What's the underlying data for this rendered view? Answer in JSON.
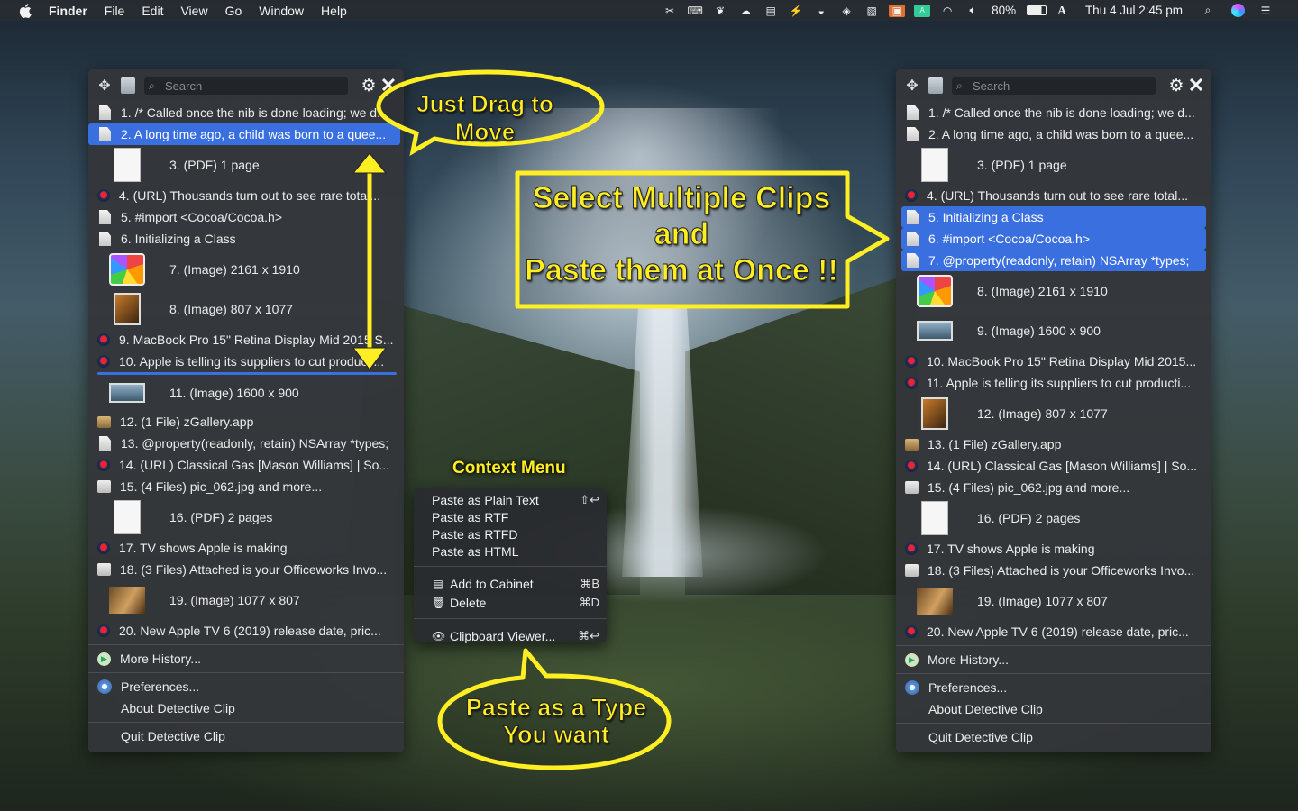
{
  "menubar": {
    "app_name": "Finder",
    "items": [
      "File",
      "Edit",
      "View",
      "Go",
      "Window",
      "Help"
    ],
    "battery": "80%",
    "input_source": "A",
    "datetime": "Thu 4 Jul  2:45 pm"
  },
  "left_panel": {
    "search_placeholder": "Search",
    "clips": [
      {
        "label": "1. /* Called once the nib is done loading; we d...",
        "icon": "document-icon"
      },
      {
        "label": "2. A long time ago, a child was born to a quee...",
        "icon": "document-icon",
        "selected": true
      },
      {
        "label": "3. (PDF) 1 page",
        "icon": "pdf-thumbnail"
      },
      {
        "label": "4. (URL) Thousands turn out to see rare total...",
        "icon": "url-icon"
      },
      {
        "label": "5. #import <Cocoa/Cocoa.h>",
        "icon": "document-icon"
      },
      {
        "label": "6. Initializing a Class",
        "icon": "document-icon"
      },
      {
        "label": "7. (Image) 2161 x 1910",
        "icon": "image-thumbnail"
      },
      {
        "label": "8. (Image) 807 x 1077",
        "icon": "image-thumbnail"
      },
      {
        "label": "9. MacBook Pro 15\" Retina Display Mid 2015 S...",
        "icon": "url-icon"
      },
      {
        "label": "10. Apple is telling its suppliers to cut producti...",
        "icon": "url-icon"
      },
      {
        "label": "11. (Image) 1600 x 900",
        "icon": "image-thumbnail"
      },
      {
        "label": "12. (1 File) zGallery.app",
        "icon": "app-icon"
      },
      {
        "label": "13. @property(readonly, retain) NSArray *types;",
        "icon": "document-icon"
      },
      {
        "label": "14. (URL) Classical Gas [Mason Williams] | So...",
        "icon": "url-icon"
      },
      {
        "label": "15. (4 Files) pic_062.jpg and more...",
        "icon": "files-icon"
      },
      {
        "label": "16. (PDF) 2 pages",
        "icon": "pdf-thumbnail"
      },
      {
        "label": "17. TV shows Apple is making",
        "icon": "url-icon"
      },
      {
        "label": "18. (3 Files) Attached is your Officeworks Invo...",
        "icon": "files-icon"
      },
      {
        "label": "19. (Image) 1077 x 807",
        "icon": "image-thumbnail"
      },
      {
        "label": "20. New Apple TV 6 (2019) release date, pric...",
        "icon": "url-icon"
      }
    ],
    "more_history": "More History...",
    "preferences": "Preferences...",
    "about": "About Detective Clip",
    "quit": "Quit Detective Clip"
  },
  "right_panel": {
    "search_placeholder": "Search",
    "clips": [
      {
        "label": "1. /* Called once the nib is done loading; we d...",
        "icon": "document-icon"
      },
      {
        "label": "2. A long time ago, a child was born to a quee...",
        "icon": "document-icon"
      },
      {
        "label": "3. (PDF) 1 page",
        "icon": "pdf-thumbnail"
      },
      {
        "label": "4. (URL) Thousands turn out to see rare total...",
        "icon": "url-icon"
      },
      {
        "label": "5. Initializing a Class",
        "icon": "document-icon",
        "selected": true
      },
      {
        "label": "6. #import <Cocoa/Cocoa.h>",
        "icon": "document-icon",
        "selected": true
      },
      {
        "label": "7. @property(readonly, retain) NSArray *types;",
        "icon": "document-icon",
        "selected": true
      },
      {
        "label": "8. (Image) 2161 x 1910",
        "icon": "image-thumbnail"
      },
      {
        "label": "9. (Image) 1600 x 900",
        "icon": "image-thumbnail"
      },
      {
        "label": "10. MacBook Pro 15\" Retina Display Mid 2015...",
        "icon": "url-icon"
      },
      {
        "label": "11. Apple is telling its suppliers to cut producti...",
        "icon": "url-icon"
      },
      {
        "label": "12. (Image) 807 x 1077",
        "icon": "image-thumbnail"
      },
      {
        "label": "13. (1 File) zGallery.app",
        "icon": "app-icon"
      },
      {
        "label": "14. (URL) Classical Gas [Mason Williams] | So...",
        "icon": "url-icon"
      },
      {
        "label": "15. (4 Files) pic_062.jpg and more...",
        "icon": "files-icon"
      },
      {
        "label": "16. (PDF) 2 pages",
        "icon": "pdf-thumbnail"
      },
      {
        "label": "17. TV shows Apple is making",
        "icon": "url-icon"
      },
      {
        "label": "18. (3 Files) Attached is your Officeworks Invo...",
        "icon": "files-icon"
      },
      {
        "label": "19. (Image) 1077 x 807",
        "icon": "image-thumbnail"
      },
      {
        "label": "20. New Apple TV 6 (2019) release date, pric...",
        "icon": "url-icon"
      }
    ],
    "more_history": "More History...",
    "preferences": "Preferences...",
    "about": "About Detective Clip",
    "quit": "Quit Detective Clip"
  },
  "context_menu": {
    "title": "Context Menu",
    "paste_plain": "Paste as Plain Text",
    "paste_plain_shortcut": "⇧↩",
    "paste_rtf": "Paste as RTF",
    "paste_rtfd": "Paste as RTFD",
    "paste_html": "Paste as HTML",
    "add_cabinet": "Add to Cabinet",
    "add_cabinet_shortcut": "⌘B",
    "delete": "Delete",
    "delete_shortcut": "⌘D",
    "viewer": "Clipboard Viewer...",
    "viewer_shortcut": "⌘↩"
  },
  "callouts": {
    "drag": "Just Drag to Move",
    "select_line1": "Select Multiple Clips",
    "select_line2": "and",
    "select_line3": "Paste them at Once !!",
    "paste_line1": "Paste as a Type",
    "paste_line2": "You want"
  },
  "colors": {
    "selection": "#3a6fe0",
    "callout_yellow": "#ffee22"
  }
}
